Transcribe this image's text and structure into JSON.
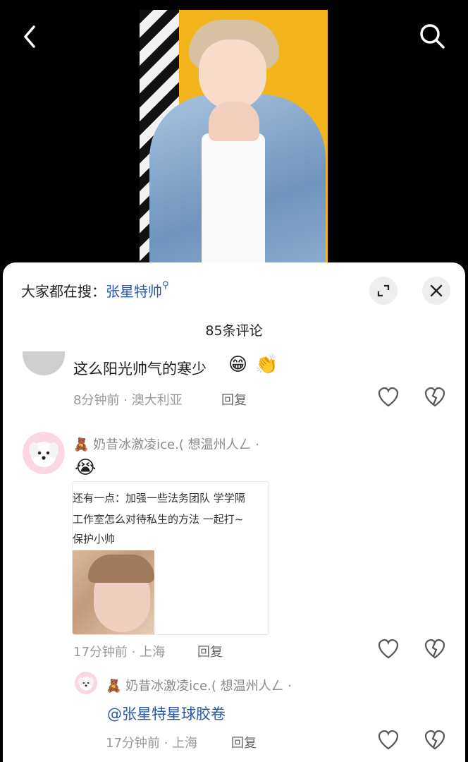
{
  "nav": {
    "back_icon": "chevron-left-icon",
    "search_icon": "search-icon"
  },
  "sheet": {
    "search_hint_prefix": "大家都在搜：",
    "search_hint_keyword": "张星特帅",
    "comment_count": "85条评论"
  },
  "comments": [
    {
      "text": "这么阳光帅气的寒少",
      "emojis": [
        "😁",
        "👏"
      ],
      "time": "8分钟前",
      "location": "澳大利亚",
      "reply_label": "回复"
    },
    {
      "username": "🧸 奶昔冰激凌ice.( 想温州人ㄥ ·",
      "emoji": "😭",
      "attachment_lines": [
        "还有一点：加强一些法务团队 学学隔",
        "工作室怎么对待私生的方法 一起打~",
        "保护小帅"
      ],
      "time": "17分钟前",
      "location": "上海",
      "reply_label": "回复",
      "reply": {
        "username": "🧸 奶昔冰激凌ice.( 想温州人ㄥ ·",
        "text": "@张星特星球胶卷",
        "time": "17分钟前",
        "location": "上海",
        "reply_label": "回复"
      }
    }
  ]
}
